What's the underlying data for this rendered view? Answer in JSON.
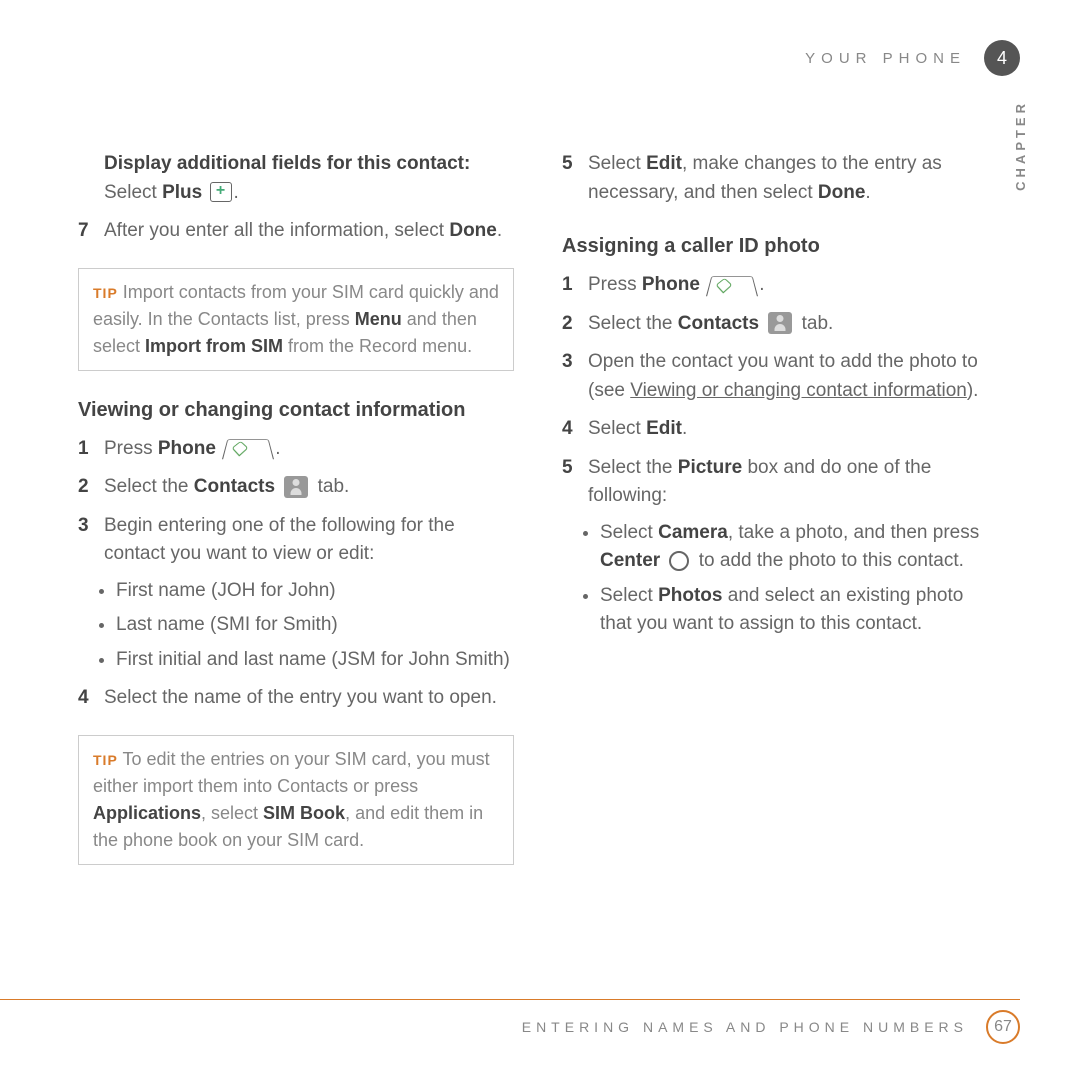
{
  "header": {
    "section": "YOUR PHONE",
    "chapter_num": "4",
    "side_label": "CHAPTER"
  },
  "left": {
    "intro": {
      "bold1": "Display additional fields for this contact:",
      "rest1": " Select ",
      "bold2": "Plus"
    },
    "step7_num": "7",
    "step7a": "After you enter all the information, select ",
    "step7b": "Done",
    "step7c": ".",
    "tip1_a": "Import contacts from your SIM card quickly and easily. In the Contacts list, press ",
    "tip1_b": "Menu",
    "tip1_c": " and then select ",
    "tip1_d": "Import from SIM",
    "tip1_e": " from the Record menu.",
    "h1": "Viewing or changing contact information",
    "s1_num": "1",
    "s1a": "Press ",
    "s1b": "Phone",
    "s1c": ".",
    "s2_num": "2",
    "s2a": "Select the ",
    "s2b": "Contacts",
    "s2c": " tab.",
    "s3_num": "3",
    "s3": "Begin entering one of the following for the contact you want to view or edit:",
    "b1": "First name (JOH for John)",
    "b2": "Last name (SMI for Smith)",
    "b3": "First initial and last name (JSM for John Smith)",
    "s4_num": "4",
    "s4": "Select the name of the entry you want to open.",
    "tip2_a": "To edit the entries on your SIM card, you must either import them into Contacts or press ",
    "tip2_b": "Applications",
    "tip2_c": ", select ",
    "tip2_d": "SIM Book",
    "tip2_e": ", and edit them in the phone book on your SIM card.",
    "tip_label": "TIP"
  },
  "right": {
    "s5_num": "5",
    "s5a": "Select ",
    "s5b": "Edit",
    "s5c": ", make changes to the entry as necessary, and then select ",
    "s5d": "Done",
    "s5e": ".",
    "h2": "Assigning a caller ID photo",
    "a1_num": "1",
    "a1a": "Press ",
    "a1b": "Phone",
    "a1c": ".",
    "a2_num": "2",
    "a2a": "Select the ",
    "a2b": "Contacts",
    "a2c": " tab.",
    "a3_num": "3",
    "a3a": "Open the contact you want to add the photo to (see ",
    "a3b": "Viewing or changing contact information",
    "a3c": ").",
    "a4_num": "4",
    "a4a": "Select ",
    "a4b": "Edit",
    "a4c": ".",
    "a5_num": "5",
    "a5a": "Select the ",
    "a5b": "Picture",
    "a5c": " box and do one of the following:",
    "bb1a": "Select ",
    "bb1b": "Camera",
    "bb1c": ", take a photo, and then press ",
    "bb1d": "Center",
    "bb1e": " to add the photo to this contact.",
    "bb2a": "Select ",
    "bb2b": "Photos",
    "bb2c": " and select an existing photo that you want to assign to this contact."
  },
  "footer": {
    "text": "ENTERING NAMES AND PHONE NUMBERS",
    "page": "67"
  }
}
